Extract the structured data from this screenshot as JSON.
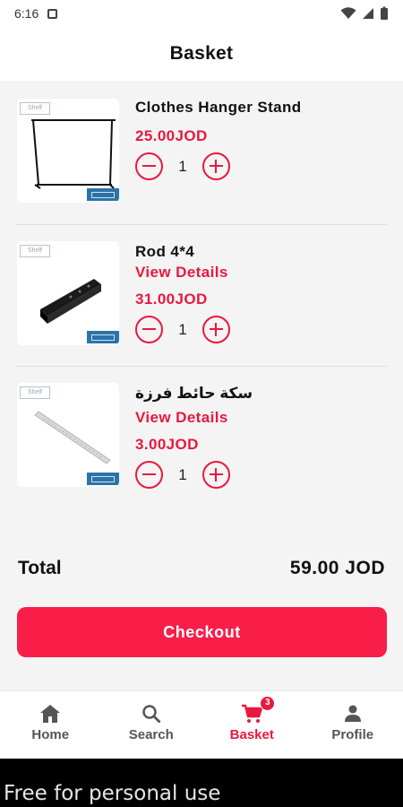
{
  "statusbar": {
    "time": "6:16"
  },
  "header": {
    "title": "Basket"
  },
  "basket": {
    "items": [
      {
        "name": "Clothes Hanger Stand",
        "details_label": "",
        "price": "25.00JOD",
        "quantity": "1"
      },
      {
        "name": "Rod 4*4",
        "details_label": "View Details",
        "price": "31.00JOD",
        "quantity": "1"
      },
      {
        "name": "سكة حائط فرزة",
        "details_label": "View Details",
        "price": "3.00JOD",
        "quantity": "1"
      }
    ],
    "total_label": "Total",
    "total_value": "59.00 JOD",
    "checkout_label": "Checkout"
  },
  "nav": {
    "items": [
      {
        "label": "Home",
        "icon": "home-icon"
      },
      {
        "label": "Search",
        "icon": "search-icon"
      },
      {
        "label": "Basket",
        "icon": "cart-icon",
        "badge": "3"
      },
      {
        "label": "Profile",
        "icon": "person-icon"
      }
    ]
  },
  "footer": {
    "text": "Free for personal use"
  },
  "colors": {
    "accent": "#e8193e",
    "button": "#f81e48"
  }
}
